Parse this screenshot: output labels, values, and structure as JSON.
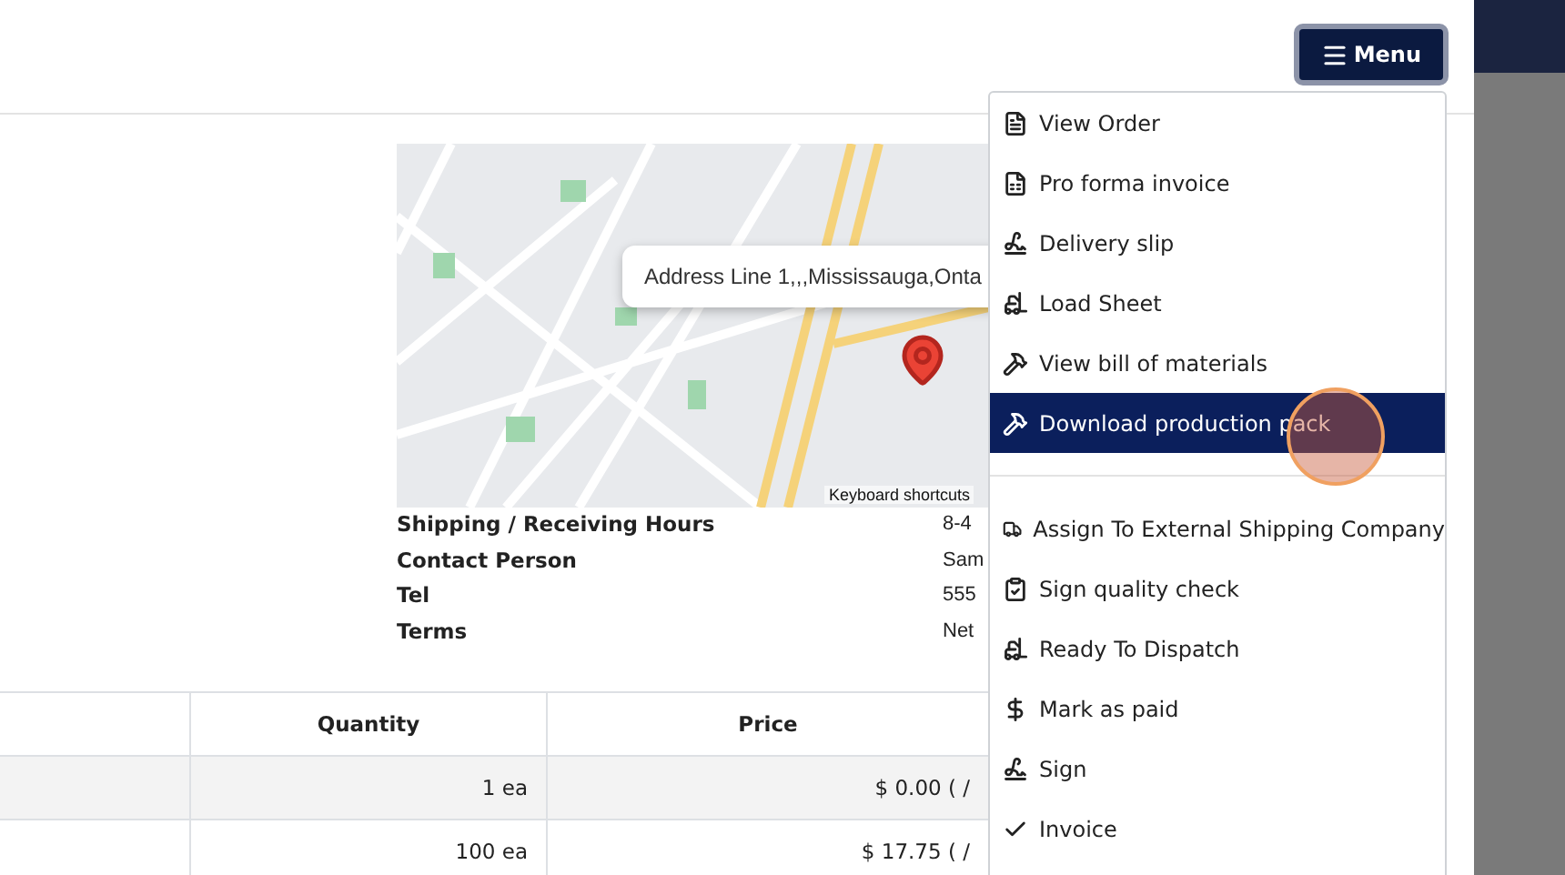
{
  "header": {
    "menu_button": {
      "label": "Menu"
    }
  },
  "map": {
    "tooltip": "Address Line 1,,,Mississauga,Onta",
    "attribution": "Keyboard shortcuts"
  },
  "details": [
    {
      "label": "Shipping / Receiving Hours",
      "value": "8-4"
    },
    {
      "label": "Contact Person",
      "value": "Sam"
    },
    {
      "label": "Tel",
      "value": "555"
    },
    {
      "label": "Terms",
      "value": "Net"
    }
  ],
  "table": {
    "columns": [
      {
        "label": "Quantity"
      },
      {
        "label": "Price"
      }
    ],
    "rows": [
      {
        "quantity": "1 ea",
        "price": "$ 0.00 ( /"
      },
      {
        "quantity": "100 ea",
        "price": "$ 17.75 ( /"
      }
    ]
  },
  "menu": {
    "groups": [
      [
        {
          "label": "View Order",
          "kind": "pdf",
          "selected": false
        },
        {
          "label": "Pro forma invoice",
          "kind": "document",
          "selected": false
        },
        {
          "label": "Delivery slip",
          "kind": "signature",
          "selected": false
        },
        {
          "label": "Load Sheet",
          "kind": "forklift",
          "selected": false
        },
        {
          "label": "View bill of materials",
          "kind": "hammer",
          "selected": false
        },
        {
          "label": "Download production pack",
          "kind": "hammer",
          "selected": true
        }
      ],
      [
        {
          "label": "Assign To External Shipping Company",
          "kind": "truck",
          "selected": false
        },
        {
          "label": "Sign quality check",
          "kind": "clipboard",
          "selected": false
        },
        {
          "label": "Ready To Dispatch",
          "kind": "forklift",
          "selected": false
        },
        {
          "label": "Mark as paid",
          "kind": "dollar",
          "selected": false
        },
        {
          "label": "Sign",
          "kind": "signature",
          "selected": false
        },
        {
          "label": "Invoice",
          "kind": "check",
          "selected": false
        }
      ]
    ]
  }
}
